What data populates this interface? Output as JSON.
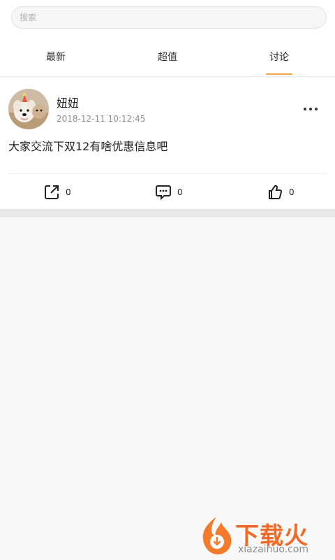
{
  "search": {
    "placeholder": "搜索"
  },
  "tabs": [
    {
      "label": "最新"
    },
    {
      "label": "超值"
    },
    {
      "label": "讨论"
    }
  ],
  "active_tab_color": "#f0a83a",
  "post": {
    "author": "妞妞",
    "timestamp": "2018-12-11 10:12:45",
    "content": "大家交流下双12有啥优惠信息吧",
    "actions": {
      "share_count": "0",
      "comment_count": "0",
      "like_count": "0"
    }
  },
  "watermark": {
    "brand": "下载火",
    "domain": "xiazaihuo.com"
  }
}
